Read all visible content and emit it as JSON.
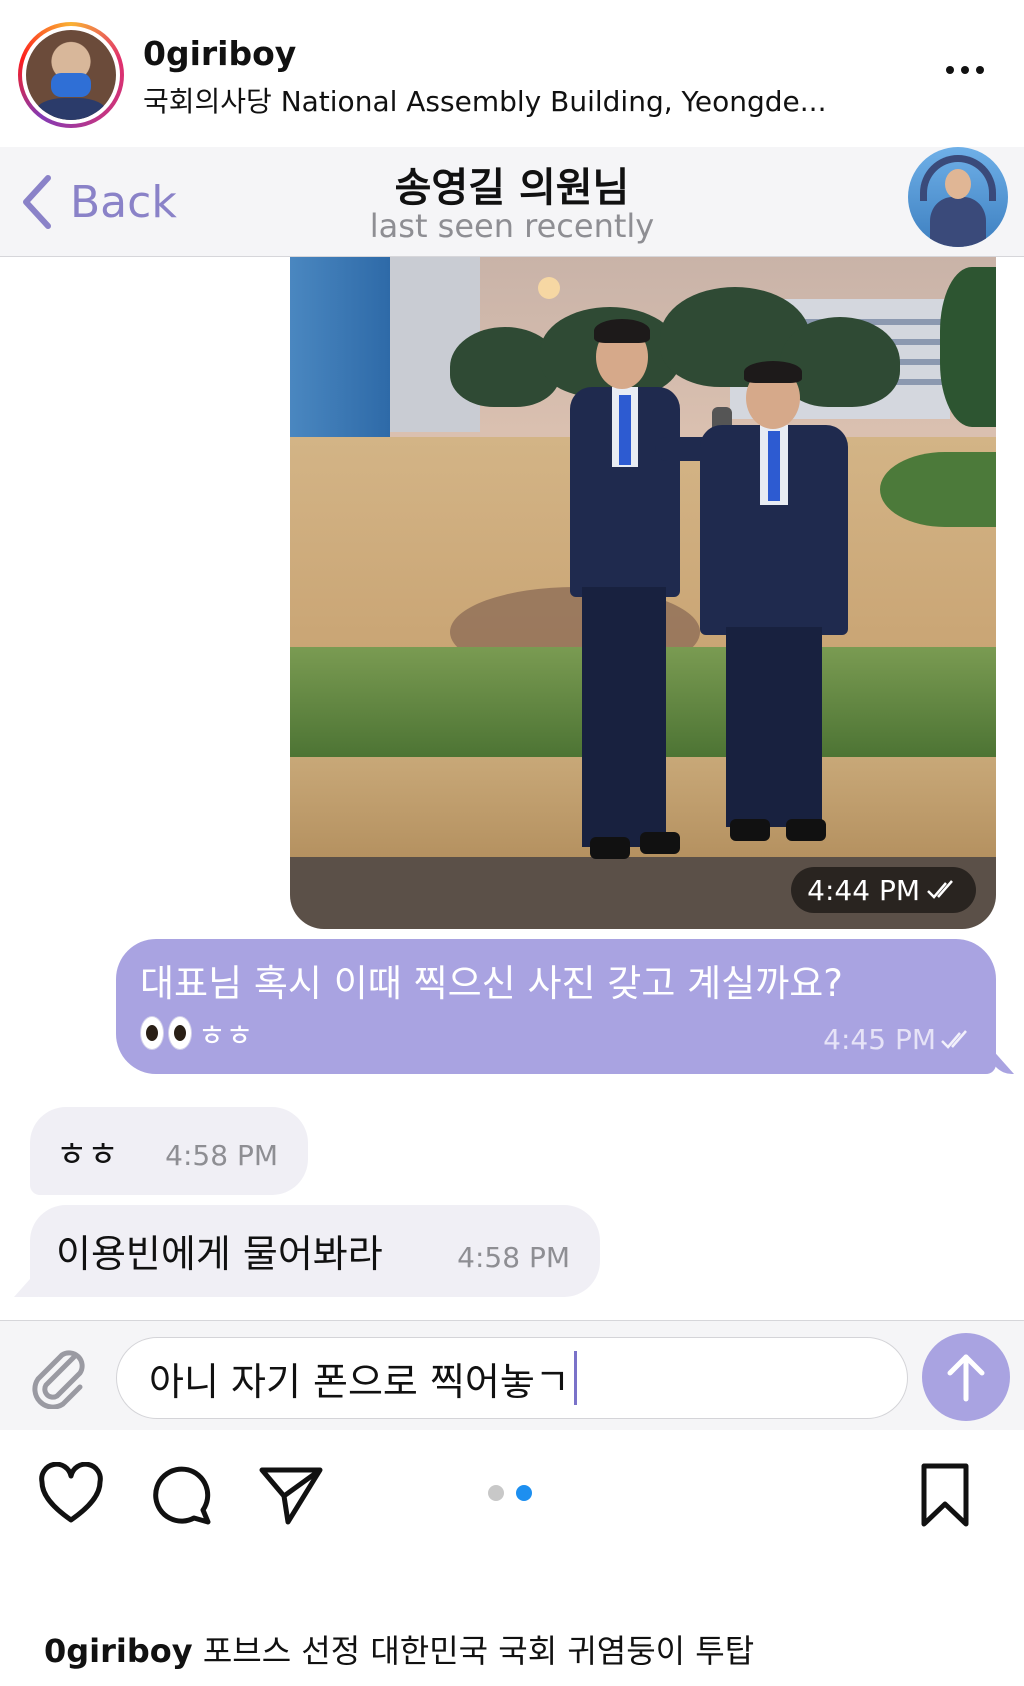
{
  "post": {
    "username": "0giriboy",
    "location": "국회의사당 National Assembly Building, Yeongde...",
    "caption_username": "0giriboy",
    "caption_text": "포브스 선정 대한민국 국회 귀염둥이 투탑",
    "carousel": {
      "total": 2,
      "active_index": 1,
      "active_color": "#1d8ff0",
      "inactive_color": "#c8c8c8"
    }
  },
  "chat": {
    "back_label": "Back",
    "title": "송영길 의원님",
    "status": "last seen recently",
    "messages": [
      {
        "type": "photo",
        "direction": "out",
        "time": "4:44 PM",
        "read": true
      },
      {
        "type": "text",
        "direction": "out",
        "text": "대표님 혹시 이때 찍으신 사진 갖고 계실까요?",
        "text2": "ㅎㅎ",
        "emoji": "eyes",
        "time": "4:45 PM",
        "read": true
      },
      {
        "type": "text",
        "direction": "in",
        "text": "ㅎㅎ",
        "time": "4:58 PM"
      },
      {
        "type": "text",
        "direction": "in",
        "text": "이용빈에게 물어봐라",
        "time": "4:58 PM"
      }
    ],
    "composer_value": "아니 자기 폰으로 찍어놓ㄱ"
  },
  "colors": {
    "accent": "#a9a3e1",
    "back_color": "#8a82c8",
    "incoming_bubble": "#f0eff5"
  },
  "icons": {
    "more": "more-horizontal-icon",
    "attach": "paperclip-icon",
    "send": "arrow-up-icon",
    "like": "heart-icon",
    "comment": "comment-bubble-icon",
    "share": "paper-plane-icon",
    "save": "bookmark-icon"
  }
}
